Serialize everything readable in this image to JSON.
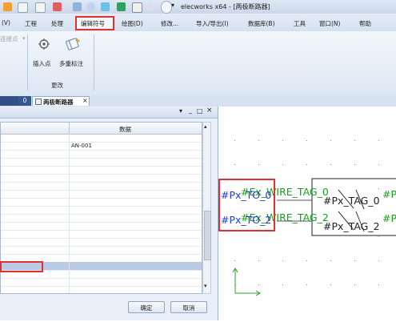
{
  "window": {
    "title": "elecworks x64 - [两极断路器]"
  },
  "menu": {
    "items": [
      "(V)",
      "工程",
      "处理",
      "编辑符号",
      "绘图(D)",
      "修改...",
      "导入/导出(I)",
      "数据库(B)",
      "工具",
      "窗口(N)",
      "帮助"
    ]
  },
  "ribbon": {
    "left_group_label": "连接点",
    "insert_point_label": "插入点",
    "multi_mark_label": "多重标注",
    "group_label": "更改"
  },
  "tabs": {
    "number_tab": "0",
    "document_tab": "两极断路器"
  },
  "dialog": {
    "column_data": "数据",
    "first_value": "AN-001",
    "ok_label": "确定",
    "cancel_label": "取消",
    "min_glyph": "_",
    "max_glyph": "□",
    "close_glyph": "×",
    "header_pin_glyph": "▾"
  },
  "canvas": {
    "tag1": "#Px_TO_0",
    "tag2": "#Px_TO_2",
    "wire1": "#Ex_WIRE_TAG_0",
    "wire2": "#Ex_WIRE_TAG_2",
    "box1": "#Px_TAG_0",
    "box2": "#Px_TAG_2",
    "edge1": "#P",
    "edge2": "#P"
  },
  "colors": {
    "highlight_red": "#e03030",
    "tag_blue": "#1f3fd0",
    "tag_green": "#18a018"
  }
}
